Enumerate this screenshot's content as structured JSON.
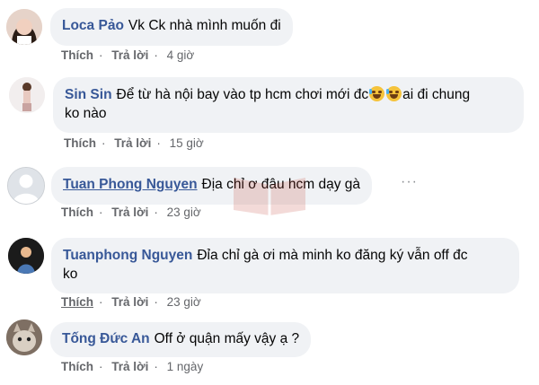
{
  "comments": [
    {
      "author": "Loca Pảo",
      "text": "Vk Ck nhà mình muốn đi",
      "actions": {
        "like": "Thích",
        "reply": "Trả lời",
        "time": "4 giờ"
      }
    },
    {
      "author": "Sin Sin",
      "text_part1": "Để từ hà nội bay vào tp hcm chơi mới đc",
      "text_part2": "ai đi chung",
      "text_line2": "ko nào",
      "emoji": "rolling-on-floor-laughing-icon",
      "actions": {
        "like": "Thích",
        "reply": "Trả lời",
        "time": "15 giờ"
      }
    },
    {
      "author": "Tuan Phong Nguyen",
      "text": "Địa chỉ ơ đâu hcm dạy gà",
      "actions": {
        "like": "Thích",
        "reply": "Trả lời",
        "time": "23 giờ"
      }
    },
    {
      "author": "Tuanphong Nguyen",
      "text_line1": "Đỉa chỉ gà ơi mà minh ko đăng ký vẫn off đc",
      "text_line2": "ko",
      "actions": {
        "like": "Thích",
        "reply": "Trả lời",
        "time": "23 giờ"
      }
    },
    {
      "author": "Tống Đức An",
      "text": "Off ở quận mấy vậy ạ ?",
      "actions": {
        "like": "Thích",
        "reply": "Trả lời",
        "time": "1 ngày"
      }
    }
  ],
  "colors": {
    "author": "#385898",
    "bubble": "#f0f2f5",
    "meta": "#65676b"
  }
}
